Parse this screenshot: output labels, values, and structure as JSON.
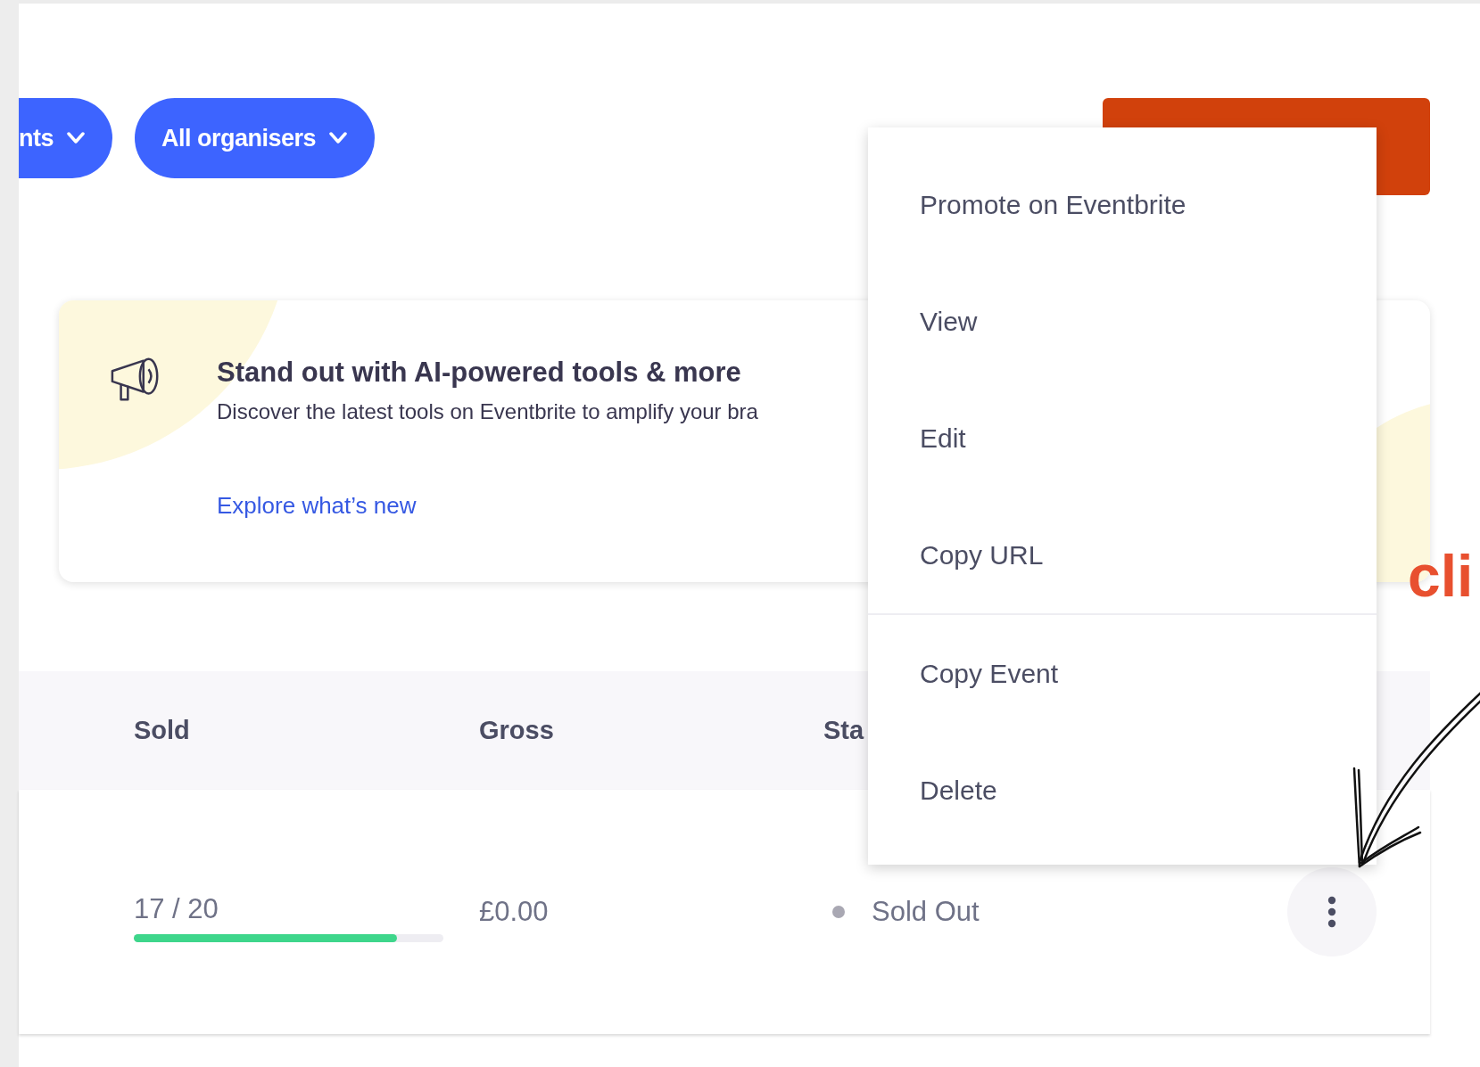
{
  "filters": [
    {
      "label": "nts"
    },
    {
      "label": "All organisers"
    }
  ],
  "banner": {
    "title": "Stand out with AI-powered tools & more",
    "description": "Discover the latest tools on Eventbrite to amplify your bra",
    "link": "Explore what’s new"
  },
  "table": {
    "columns": [
      "Sold",
      "Gross",
      "Sta"
    ],
    "rows": [
      {
        "sold": "17 / 20",
        "level": 0.85,
        "gross": "£0.00",
        "status": "Sold Out"
      }
    ]
  },
  "menu": {
    "groups": [
      [
        {
          "label": "Promote on Eventbrite"
        },
        {
          "label": "View"
        },
        {
          "label": "Edit"
        },
        {
          "label": "Copy URL"
        }
      ],
      [
        {
          "label": "Copy Event"
        },
        {
          "label": "Delete"
        }
      ]
    ]
  },
  "annotation": {
    "text": "cli"
  }
}
